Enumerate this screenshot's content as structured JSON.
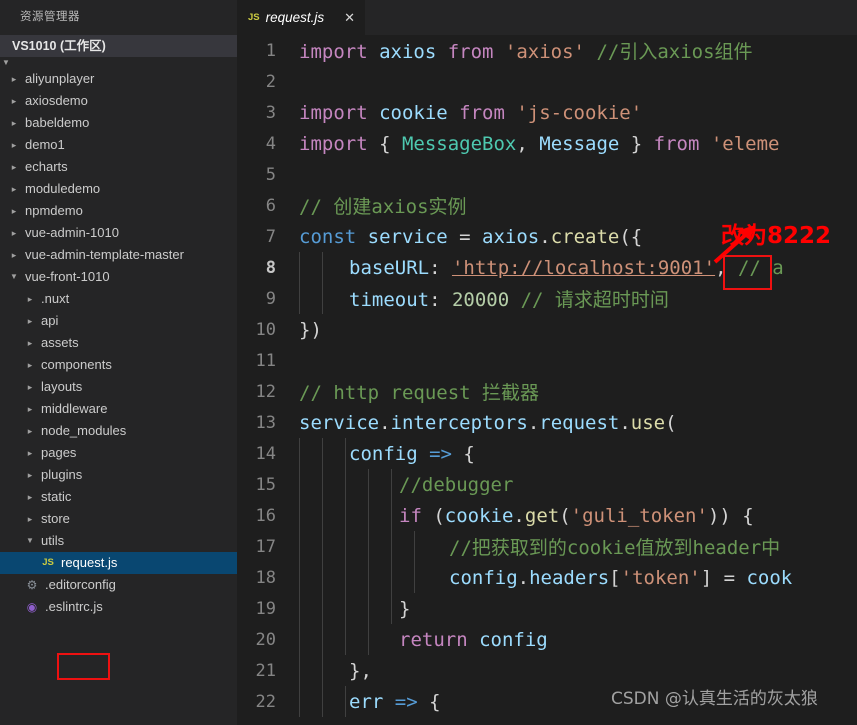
{
  "sidebar": {
    "title": "资源管理器",
    "workspace_header": "VS1010 (工作区)",
    "root_clipped_label": "VS1010",
    "items": [
      {
        "label": "aliyunplayer",
        "type": "folder",
        "state": "collapsed",
        "depth": 1
      },
      {
        "label": "axiosdemo",
        "type": "folder",
        "state": "collapsed",
        "depth": 1
      },
      {
        "label": "babeldemo",
        "type": "folder",
        "state": "collapsed",
        "depth": 1
      },
      {
        "label": "demo1",
        "type": "folder",
        "state": "collapsed",
        "depth": 1
      },
      {
        "label": "echarts",
        "type": "folder",
        "state": "collapsed",
        "depth": 1
      },
      {
        "label": "moduledemo",
        "type": "folder",
        "state": "collapsed",
        "depth": 1
      },
      {
        "label": "npmdemo",
        "type": "folder",
        "state": "collapsed",
        "depth": 1
      },
      {
        "label": "vue-admin-1010",
        "type": "folder",
        "state": "collapsed",
        "depth": 1
      },
      {
        "label": "vue-admin-template-master",
        "type": "folder",
        "state": "collapsed",
        "depth": 1
      },
      {
        "label": "vue-front-1010",
        "type": "folder",
        "state": "expanded",
        "depth": 1
      },
      {
        "label": ".nuxt",
        "type": "folder",
        "state": "collapsed",
        "depth": 2
      },
      {
        "label": "api",
        "type": "folder",
        "state": "collapsed",
        "depth": 2
      },
      {
        "label": "assets",
        "type": "folder",
        "state": "collapsed",
        "depth": 2
      },
      {
        "label": "components",
        "type": "folder",
        "state": "collapsed",
        "depth": 2
      },
      {
        "label": "layouts",
        "type": "folder",
        "state": "collapsed",
        "depth": 2
      },
      {
        "label": "middleware",
        "type": "folder",
        "state": "collapsed",
        "depth": 2
      },
      {
        "label": "node_modules",
        "type": "folder",
        "state": "collapsed",
        "depth": 2
      },
      {
        "label": "pages",
        "type": "folder",
        "state": "collapsed",
        "depth": 2
      },
      {
        "label": "plugins",
        "type": "folder",
        "state": "collapsed",
        "depth": 2
      },
      {
        "label": "static",
        "type": "folder",
        "state": "collapsed",
        "depth": 2
      },
      {
        "label": "store",
        "type": "folder",
        "state": "collapsed",
        "depth": 2
      },
      {
        "label": "utils",
        "type": "folder",
        "state": "expanded",
        "depth": 2
      },
      {
        "label": "request.js",
        "type": "file",
        "icon": "js-file-icon",
        "depth": 3,
        "selected": true
      },
      {
        "label": ".editorconfig",
        "type": "file",
        "icon": "gear-icon",
        "depth": 2
      },
      {
        "label": ".eslintrc.js",
        "type": "file",
        "icon": "eslint-icon",
        "depth": 2
      }
    ]
  },
  "tab": {
    "icon": "js-file-icon",
    "filename": "request.js",
    "close_label": "✕"
  },
  "editor": {
    "active_line": 8,
    "lines": [
      {
        "num": 1
      },
      {
        "num": 2
      },
      {
        "num": 3
      },
      {
        "num": 4
      },
      {
        "num": 5
      },
      {
        "num": 6
      },
      {
        "num": 7
      },
      {
        "num": 8
      },
      {
        "num": 9
      },
      {
        "num": 10
      },
      {
        "num": 11
      },
      {
        "num": 12
      },
      {
        "num": 13
      },
      {
        "num": 14
      },
      {
        "num": 15
      },
      {
        "num": 16
      },
      {
        "num": 17
      },
      {
        "num": 18
      },
      {
        "num": 19
      },
      {
        "num": 20
      },
      {
        "num": 21
      },
      {
        "num": 22
      }
    ],
    "text": {
      "l1_import": "import",
      "l1_axios": " axios ",
      "l1_from": "from",
      "l1_str": " 'axios' ",
      "l1_comment": "//引入axios组件",
      "l3_import": "import",
      "l3_cookie": " cookie ",
      "l3_from": "from",
      "l3_str": " 'js-cookie'",
      "l4_import": "import",
      "l4_brace": " { ",
      "l4_msgbox": "MessageBox",
      "l4_comma": ", ",
      "l4_message": "Message",
      "l4_brace2": " } ",
      "l4_from": "from",
      "l4_str": " 'eleme",
      "l6_comment": "// 创建axios实例",
      "l7_const": "const",
      "l7_service": " service ",
      "l7_eq": "= ",
      "l7_axios": "axios",
      "l7_dot": ".",
      "l7_create": "create",
      "l7_paren": "({",
      "l8_key": "baseURL",
      "l8_colon": ": ",
      "l8_url_pre": "'http://localhost:",
      "l8_port": "9001",
      "l8_url_post": "'",
      "l8_tail": ", ",
      "l8_comment": "// a",
      "l9_key": "timeout",
      "l9_colon": ": ",
      "l9_num": "20000",
      "l9_comment": " // 请求超时时间",
      "l10_close": "})",
      "l12_comment": "// http request 拦截器",
      "l13_service": "service",
      "l13_d1": ".",
      "l13_interceptors": "interceptors",
      "l13_d2": ".",
      "l13_request": "request",
      "l13_d3": ".",
      "l13_use": "use",
      "l13_paren": "(",
      "l14_config": "config ",
      "l14_arrow": "=> ",
      "l14_brace": "{",
      "l15_comment": "//debugger",
      "l16_if": "if",
      "l16_paren": " (",
      "l16_cookie": "cookie",
      "l16_dot": ".",
      "l16_get": "get",
      "l16_p2": "(",
      "l16_str": "'guli_token'",
      "l16_p3": ")) {",
      "l17_comment": "//把获取到的cookie值放到header中",
      "l18_config": "config",
      "l18_dot": ".",
      "l18_headers": "headers",
      "l18_b1": "[",
      "l18_str": "'token'",
      "l18_b2": "] ",
      "l18_eq": "= ",
      "l18_cook": "cook",
      "l19_close": "}",
      "l20_return": "return",
      "l20_config": " config",
      "l21_close": "},",
      "l22_err": "err ",
      "l22_arrow": "=> ",
      "l22_brace": "{"
    }
  },
  "annotations": {
    "change_to_note": "改为8222",
    "highlight_port": "9001",
    "highlight_file": "request.js",
    "arrow": "red-arrow-icon",
    "accent_color": "#ff0000"
  },
  "watermark": {
    "text": "CSDN @认真生活的灰太狼"
  }
}
